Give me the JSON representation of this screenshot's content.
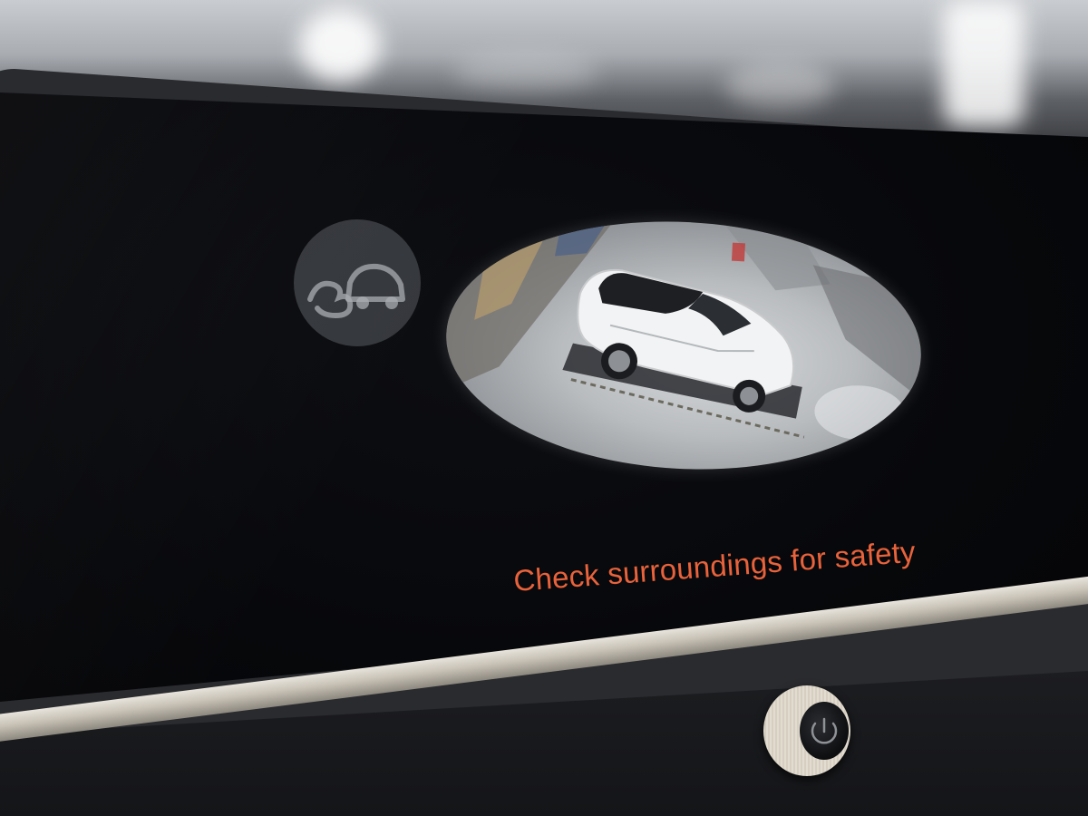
{
  "display": {
    "warning_text": "Check surroundings for safety",
    "warning_color": "#e8623b"
  },
  "camera": {
    "mode": "360-surround-view",
    "icon": "car-top-view-icon"
  },
  "controls": {
    "power_knob_icon": "power-icon"
  },
  "watermark": {
    "icon": "watermark-logo-icon"
  }
}
